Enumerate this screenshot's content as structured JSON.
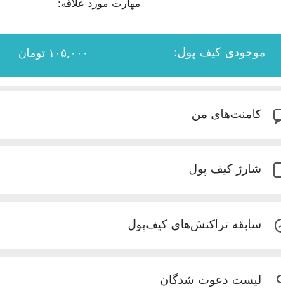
{
  "header": {
    "skills_label": "مهارت مورد علاقه:"
  },
  "wallet": {
    "title": "موجودی کیف پول:",
    "amount": "۱۰۵,۰۰۰ تومان",
    "color": "#2fb3c2"
  },
  "menu": {
    "items": [
      {
        "label": "کامنت‌های من",
        "icon": "comment-icon"
      },
      {
        "label": "شارژ کیف پول",
        "icon": "wallet-charge-icon"
      },
      {
        "label": "سابقه تراکنش‌های کیف‌پول",
        "icon": "history-icon"
      },
      {
        "label": "لیست دعوت شدگان",
        "icon": "invite-list-icon"
      }
    ]
  }
}
